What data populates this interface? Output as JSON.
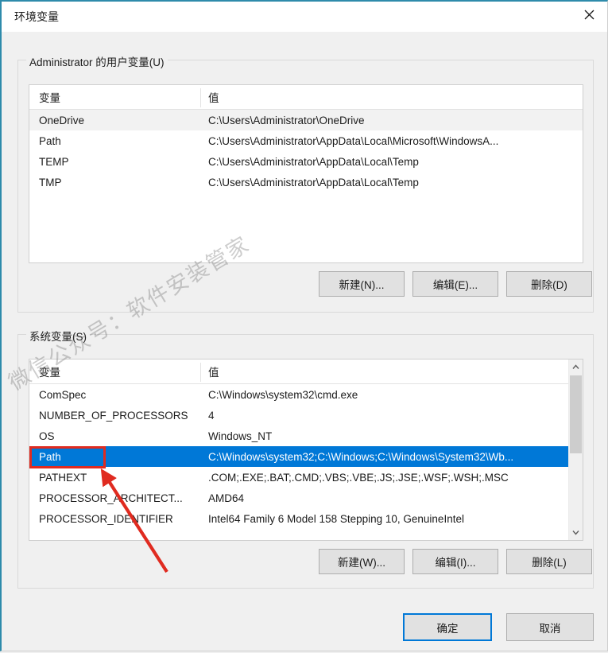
{
  "window": {
    "title": "环境变量",
    "close_label": "close-icon"
  },
  "user_section": {
    "legend": "Administrator 的用户变量(U)",
    "columns": [
      "变量",
      "值"
    ],
    "rows": [
      {
        "name": "OneDrive",
        "value": "C:\\Users\\Administrator\\OneDrive",
        "selected": false,
        "alt": true
      },
      {
        "name": "Path",
        "value": "C:\\Users\\Administrator\\AppData\\Local\\Microsoft\\WindowsA...",
        "selected": false,
        "alt": false
      },
      {
        "name": "TEMP",
        "value": "C:\\Users\\Administrator\\AppData\\Local\\Temp",
        "selected": false,
        "alt": false
      },
      {
        "name": "TMP",
        "value": "C:\\Users\\Administrator\\AppData\\Local\\Temp",
        "selected": false,
        "alt": false
      }
    ],
    "buttons": {
      "new": "新建(N)...",
      "edit": "编辑(E)...",
      "delete": "删除(D)"
    }
  },
  "system_section": {
    "legend": "系统变量(S)",
    "columns": [
      "变量",
      "值"
    ],
    "rows": [
      {
        "name": "ComSpec",
        "value": "C:\\Windows\\system32\\cmd.exe",
        "selected": false,
        "alt": false
      },
      {
        "name": "NUMBER_OF_PROCESSORS",
        "value": "4",
        "selected": false,
        "alt": false
      },
      {
        "name": "OS",
        "value": "Windows_NT",
        "selected": false,
        "alt": false
      },
      {
        "name": "Path",
        "value": "C:\\Windows\\system32;C:\\Windows;C:\\Windows\\System32\\Wb...",
        "selected": true,
        "alt": false
      },
      {
        "name": "PATHEXT",
        "value": ".COM;.EXE;.BAT;.CMD;.VBS;.VBE;.JS;.JSE;.WSF;.WSH;.MSC",
        "selected": false,
        "alt": false
      },
      {
        "name": "PROCESSOR_ARCHITECT...",
        "value": "AMD64",
        "selected": false,
        "alt": false
      },
      {
        "name": "PROCESSOR_IDENTIFIER",
        "value": "Intel64 Family 6 Model 158 Stepping 10, GenuineIntel",
        "selected": false,
        "alt": false
      }
    ],
    "buttons": {
      "new": "新建(W)...",
      "edit": "编辑(I)...",
      "delete": "删除(L)"
    },
    "scrollbar": {
      "up_icon": "chevron-up-icon",
      "down_icon": "chevron-down-icon"
    }
  },
  "footer": {
    "ok": "确定",
    "cancel": "取消"
  },
  "watermark": {
    "text": "微信公众号：软件安装管家"
  },
  "annotations": {
    "highlight_target": "Path",
    "arrow_color": "#e02b20",
    "rect_color": "#e02b20"
  },
  "colors": {
    "accent": "#0078d7",
    "title_border": "#2e8bab",
    "selection": "#0078d7",
    "annotation": "#e02b20"
  }
}
